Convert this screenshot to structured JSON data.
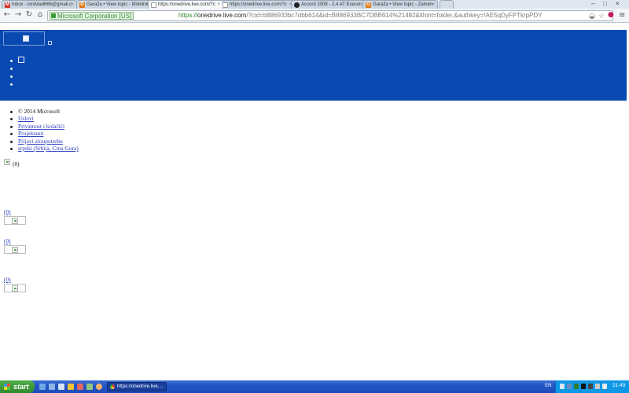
{
  "browser": {
    "tabs": [
      {
        "title": "Inbox - lordvlad666@gmail.c",
        "favicon": "gmail-icon",
        "active": false
      },
      {
        "title": "Garaža • View topic - Mobilno",
        "favicon": "garaza-icon",
        "active": false
      },
      {
        "title": "https://onedrive.live.com/?c",
        "favicon": "page-icon",
        "active": true
      },
      {
        "title": "https://onedrive.live.com/?c",
        "favicon": "page-icon",
        "active": false
      },
      {
        "title": "Accord 2008 - 2.4 AT Execut",
        "favicon": "accord-icon",
        "active": false
      },
      {
        "title": "Garaža • View topic - Zamen",
        "favicon": "garaza-icon",
        "active": false
      }
    ],
    "ev_cert": "Microsoft Corporation [US]",
    "url_scheme": "https://",
    "url_host": "onedrive.live.com",
    "url_rest": "/?cid=b886933bc7dbb614&id=B886933BC7DBB614%21482&ithint=folder,&authkey=!AE5qDyFPTkrpPDY",
    "accent_color": "#094ab2"
  },
  "page": {
    "footer": {
      "copyright": "© 2014 Microsoft",
      "links": [
        "Uslovi",
        "Privatnost i kolačići",
        "Projektanti",
        "Prijavi zloupotrebu",
        "srpski (Srbija, Crna Gora)"
      ]
    },
    "counter": "(0)",
    "items": [
      "(0)",
      "(0)",
      "(0)"
    ]
  },
  "taskbar": {
    "start_label": "start",
    "task_title": "https://onedrive.live....",
    "language": "EN",
    "clock": "21:49"
  }
}
